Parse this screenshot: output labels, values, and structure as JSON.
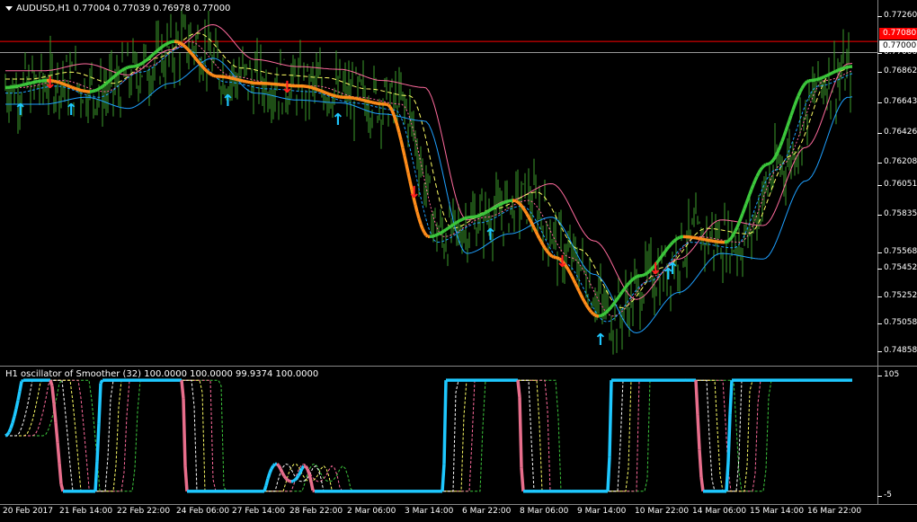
{
  "main_title": "AUDUSD,H1  0.77004 0.77039 0.76978 0.77000",
  "osc_title": "H1 oscillator of Smoother (32) 100.0000 100.0000 99.9374 100.0000",
  "price_labels": [
    "0.77260",
    "0.77000",
    "0.76862",
    "0.76643",
    "0.76426",
    "0.76208",
    "0.76051",
    "0.75835",
    "0.75568",
    "0.75452",
    "0.75252",
    "0.75058",
    "0.74858"
  ],
  "price_tag_red": "0.77080",
  "price_tag_current": "0.77000",
  "osc_labels": [
    "105",
    "-5"
  ],
  "time_labels": [
    "20 Feb 2017",
    "21 Feb 14:00",
    "22 Feb 22:00",
    "24 Feb 06:00",
    "27 Feb 14:00",
    "28 Feb 22:00",
    "2 Mar 06:00",
    "3 Mar 14:00",
    "6 Mar 22:00",
    "8 Mar 06:00",
    "9 Mar 14:00",
    "10 Mar 22:00",
    "14 Mar 06:00",
    "15 Mar 14:00",
    "16 Mar 22:00"
  ],
  "colors": {
    "background": "#000000",
    "candles": "#3c9b2d",
    "smoother_up": "#3cc83c",
    "smoother_down": "#ff8c1a",
    "band_upper": "#ff6b9d",
    "band_lower": "#1ea0ff",
    "band_mid": "#ffff66",
    "osc_up": "#1ec8ff",
    "osc_down": "#e86e8c",
    "red_line": "#ff0000",
    "arrow_up": "#1ec8ff",
    "arrow_down": "#ff2020"
  },
  "chart_data": {
    "type": "line",
    "symbol": "AUDUSD",
    "timeframe": "H1",
    "open": 0.77004,
    "high": 0.77039,
    "low": 0.76978,
    "close": 0.77,
    "ylim": [
      0.748,
      0.773
    ],
    "smoother_series": [
      {
        "t": 0,
        "v": 0.7675
      },
      {
        "t": 1,
        "v": 0.768
      },
      {
        "t": 2,
        "v": 0.7672
      },
      {
        "t": 3,
        "v": 0.769
      },
      {
        "t": 4,
        "v": 0.7708
      },
      {
        "t": 5,
        "v": 0.7683
      },
      {
        "t": 6,
        "v": 0.7678
      },
      {
        "t": 7,
        "v": 0.7676
      },
      {
        "t": 8,
        "v": 0.7668
      },
      {
        "t": 9,
        "v": 0.7663
      },
      {
        "t": 10,
        "v": 0.7568
      },
      {
        "t": 11,
        "v": 0.7582
      },
      {
        "t": 12,
        "v": 0.7594
      },
      {
        "t": 13,
        "v": 0.7553
      },
      {
        "t": 14,
        "v": 0.7511
      },
      {
        "t": 15,
        "v": 0.754
      },
      {
        "t": 16,
        "v": 0.7568
      },
      {
        "t": 17,
        "v": 0.7564
      },
      {
        "t": 18,
        "v": 0.762
      },
      {
        "t": 19,
        "v": 0.768
      },
      {
        "t": 20,
        "v": 0.769
      }
    ],
    "oscillator": {
      "name": "H1 oscillator of Smoother (32)",
      "values": [
        100.0,
        100.0,
        99.9374,
        100.0
      ],
      "ylim": [
        -5,
        105
      ]
    }
  },
  "arrows": [
    {
      "dir": "up",
      "t": 0.3
    },
    {
      "dir": "down",
      "t": 1.0
    },
    {
      "dir": "up",
      "t": 1.5
    },
    {
      "dir": "up",
      "t": 5.2
    },
    {
      "dir": "down",
      "t": 6.6
    },
    {
      "dir": "up",
      "t": 7.8
    },
    {
      "dir": "down",
      "t": 9.6
    },
    {
      "dir": "up",
      "t": 11.4
    },
    {
      "dir": "down",
      "t": 13.1
    },
    {
      "dir": "up",
      "t": 14.0
    },
    {
      "dir": "down",
      "t": 15.3
    },
    {
      "dir": "up",
      "t": 15.6
    },
    {
      "dir": "up",
      "t": 15.7
    }
  ]
}
